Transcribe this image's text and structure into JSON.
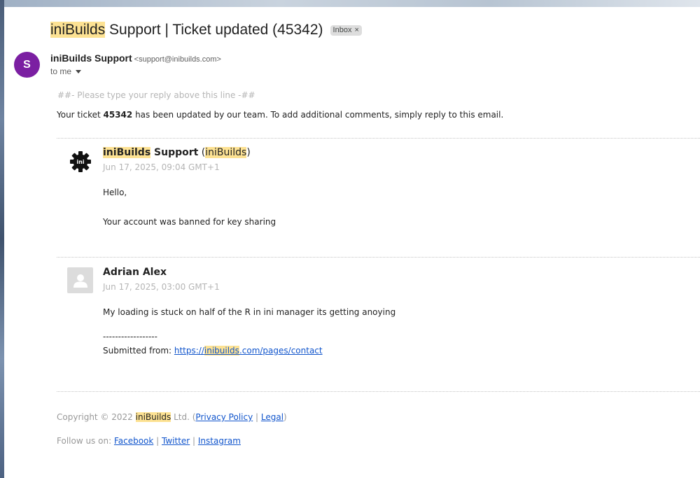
{
  "subject": {
    "brand": "iniBuilds",
    "rest": " Support | Ticket updated (45342)",
    "label": "Inbox",
    "label_close": "×"
  },
  "sender": {
    "initial": "S",
    "name": "iniBuilds Support",
    "email": "<support@inibuilds.com>",
    "to": "to me"
  },
  "body": {
    "reply_above": "##- Please type your reply above this line -##",
    "ticket_pre": "Your ticket ",
    "ticket_number": "45342",
    "ticket_post": " has been updated by our team. To add additional comments, simply reply to this email."
  },
  "entries": [
    {
      "name_brand": "iniBuilds",
      "name_rest": " Support",
      "org_open": " (",
      "org": "iniBuilds",
      "org_close": ")",
      "date": "Jun 17, 2025, 09:04 GMT+1",
      "logo_text": "ini",
      "lines": [
        "Hello,",
        "Your account was banned for key sharing"
      ]
    },
    {
      "name": "Adrian Alex",
      "date": "Jun 17, 2025, 03:00 GMT+1",
      "lines": [
        "My loading is stuck on half of the R in ini manager its getting anoying"
      ],
      "separator": "------------------",
      "submitted_label": "Submitted from: ",
      "link_pre": "https://",
      "link_brand": "inibuilds",
      "link_post": ".com/pages/contact"
    }
  ],
  "footer": {
    "copyright_pre": "Copyright © 2022 ",
    "brand": "iniBuilds",
    "copyright_post": " Ltd. (",
    "privacy": "Privacy Policy",
    "sep": " | ",
    "legal": "Legal",
    "close": ")",
    "follow": "Follow us on: ",
    "facebook": "Facebook",
    "twitter": "Twitter",
    "instagram": "Instagram"
  },
  "colors": {
    "highlight": "#fde293",
    "avatar": "#7b1fa2",
    "link": "#1155cc"
  }
}
